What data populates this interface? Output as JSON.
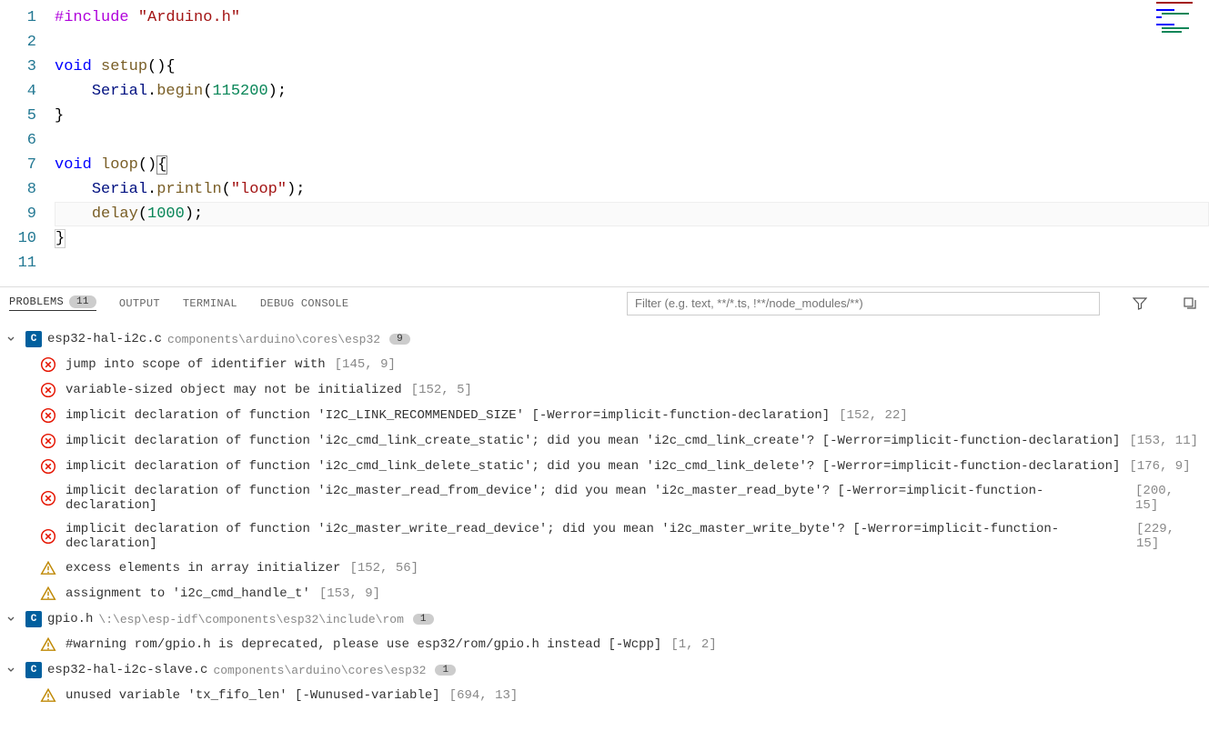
{
  "code": {
    "lines": [
      {
        "num": 1,
        "html": "<span class='tok-pp'>#include</span> <span class='tok-str'>\"Arduino.h\"</span>"
      },
      {
        "num": 2,
        "html": ""
      },
      {
        "num": 3,
        "html": "<span class='tok-kw'>void</span> <span class='tok-fn'>setup</span><span class='tok-punc'>(){</span>"
      },
      {
        "num": 4,
        "html": "    <span class='tok-obj'>Serial</span><span class='tok-punc'>.</span><span class='tok-fn'>begin</span><span class='tok-punc'>(</span><span class='tok-num'>115200</span><span class='tok-punc'>);</span>"
      },
      {
        "num": 5,
        "html": "<span class='tok-punc'>}</span>"
      },
      {
        "num": 6,
        "html": ""
      },
      {
        "num": 7,
        "html": "<span class='tok-kw'>void</span> <span class='tok-fn'>loop</span><span class='tok-punc'>()</span><span class='tok-punc' style='border:1px solid #888;'>{</span>"
      },
      {
        "num": 8,
        "html": "    <span class='tok-obj'>Serial</span><span class='tok-punc'>.</span><span class='tok-fn'>println</span><span class='tok-punc'>(</span><span class='tok-str'>\"loop\"</span><span class='tok-punc'>);</span>"
      },
      {
        "num": 9,
        "html": "    <span class='tok-fn'>delay</span><span class='tok-punc'>(</span><span class='tok-num'>1000</span><span class='tok-punc'>);</span>",
        "cursor": true
      },
      {
        "num": 10,
        "html": "<span class='tok-punc' style='border:1px solid #ccc;'>}</span>"
      },
      {
        "num": 11,
        "html": ""
      }
    ]
  },
  "panel": {
    "tabs": {
      "problems": "PROBLEMS",
      "problems_count": "11",
      "output": "OUTPUT",
      "terminal": "TERMINAL",
      "debug": "DEBUG CONSOLE"
    },
    "filter_placeholder": "Filter (e.g. text, **/*.ts, !**/node_modules/**)"
  },
  "problems": {
    "files": [
      {
        "icon": "C",
        "name": "esp32-hal-i2c.c",
        "path": "components\\arduino\\cores\\esp32",
        "count": "9",
        "items": [
          {
            "sev": "err",
            "msg": "jump into scope of identifier with",
            "loc": "[145, 9]"
          },
          {
            "sev": "err",
            "msg": "variable-sized object may not be initialized",
            "loc": "[152, 5]"
          },
          {
            "sev": "err",
            "msg": "implicit declaration of function 'I2C_LINK_RECOMMENDED_SIZE' [-Werror=implicit-function-declaration]",
            "loc": "[152, 22]"
          },
          {
            "sev": "err",
            "msg": "implicit declaration of function 'i2c_cmd_link_create_static'; did you mean 'i2c_cmd_link_create'? [-Werror=implicit-function-declaration]",
            "loc": "[153, 11]"
          },
          {
            "sev": "err",
            "msg": "implicit declaration of function 'i2c_cmd_link_delete_static'; did you mean 'i2c_cmd_link_delete'? [-Werror=implicit-function-declaration]",
            "loc": "[176, 9]"
          },
          {
            "sev": "err",
            "msg": "implicit declaration of function 'i2c_master_read_from_device'; did you mean 'i2c_master_read_byte'? [-Werror=implicit-function-declaration]",
            "loc": "[200, 15]"
          },
          {
            "sev": "err",
            "msg": "implicit declaration of function 'i2c_master_write_read_device'; did you mean 'i2c_master_write_byte'? [-Werror=implicit-function-declaration]",
            "loc": "[229, 15]"
          },
          {
            "sev": "warn",
            "msg": "excess elements in array initializer",
            "loc": "[152, 56]"
          },
          {
            "sev": "warn",
            "msg": "assignment to 'i2c_cmd_handle_t'",
            "loc": "[153, 9]"
          }
        ]
      },
      {
        "icon": "C",
        "name": "gpio.h",
        "path": "\\:\\esp\\esp-idf\\components\\esp32\\include\\rom",
        "count": "1",
        "items": [
          {
            "sev": "warn",
            "msg": "#warning rom/gpio.h is deprecated, please use esp32/rom/gpio.h instead [-Wcpp]",
            "loc": "[1, 2]"
          }
        ]
      },
      {
        "icon": "C",
        "name": "esp32-hal-i2c-slave.c",
        "path": "components\\arduino\\cores\\esp32",
        "count": "1",
        "items": [
          {
            "sev": "warn",
            "msg": "unused variable 'tx_fifo_len' [-Wunused-variable]",
            "loc": "[694, 13]"
          }
        ]
      }
    ]
  }
}
